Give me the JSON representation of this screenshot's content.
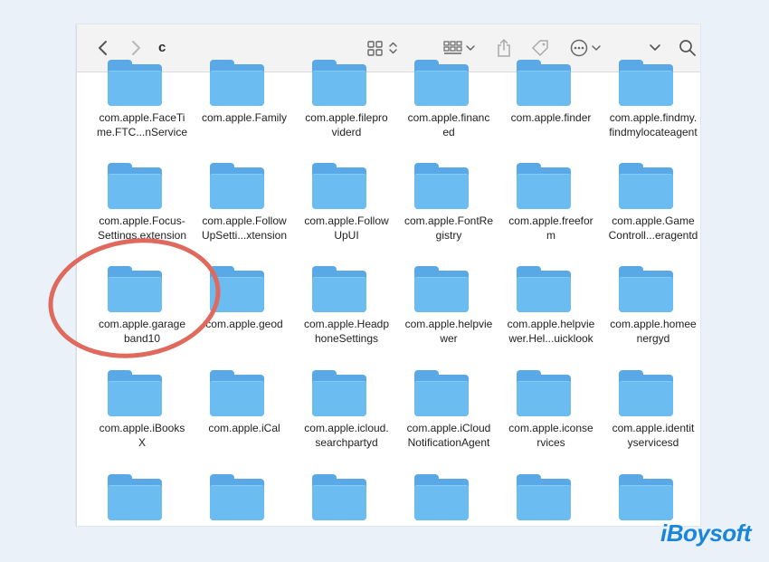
{
  "window": {
    "title": "c",
    "toolbar": {
      "icons": [
        "chevron-left-icon",
        "chevron-right-icon",
        "icon-grid-view-icon",
        "gallery-view-icon",
        "share-icon",
        "tag-icon",
        "more-options-icon",
        "chevron-down-icon",
        "search-icon"
      ]
    }
  },
  "folders": [
    [
      "com.apple.FaceTi\nme.FTC...nService",
      "com.apple.Family",
      "com.apple.filepro\nviderd",
      "com.apple.financ\ned",
      "com.apple.finder",
      "com.apple.findmy.\nfindmylocateagent"
    ],
    [
      "com.apple.Focus-\nSettings.extension",
      "com.apple.Follow\nUpSetti...xtension",
      "com.apple.Follow\nUpUI",
      "com.apple.FontRe\ngistry",
      "com.apple.freefor\nm",
      "com.apple.Game\nControll...eragentd"
    ],
    [
      "com.apple.garage\nband10",
      "com.apple.geod",
      "com.apple.Headp\nhoneSettings",
      "com.apple.helpvie\nwer",
      "com.apple.helpvie\nwer.Hel...uicklook",
      "com.apple.homee\nnergyd"
    ],
    [
      "com.apple.iBooks\nX",
      "com.apple.iCal",
      "com.apple.icloud.\nsearchpartyd",
      "com.apple.iCloud\nNotificationAgent",
      "com.apple.iconse\nrvices",
      "com.apple.identit\nyservicesd"
    ],
    [
      "",
      "",
      "",
      "",
      "",
      ""
    ]
  ],
  "highlight": "com.apple.garageband10",
  "watermark": "iBoysoft",
  "colors": {
    "folder": "#6bbcf0",
    "circle": "#e0695e",
    "brand": "#1a86d9"
  }
}
